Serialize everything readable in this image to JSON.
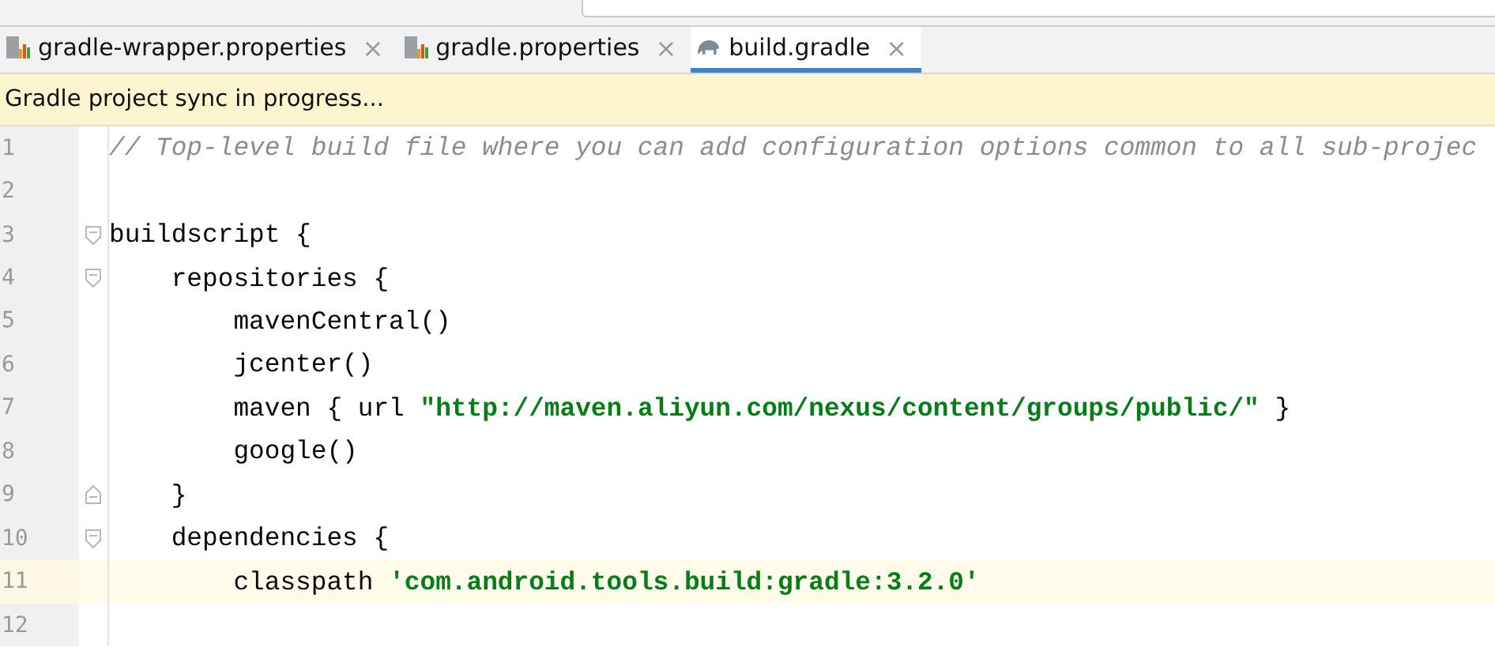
{
  "tabs": [
    {
      "label": "gradle-wrapper.properties",
      "kind": "properties",
      "close": "×",
      "selected": false
    },
    {
      "label": "gradle.properties",
      "kind": "properties",
      "close": "×",
      "selected": false
    },
    {
      "label": "build.gradle",
      "kind": "gradle",
      "close": "×",
      "selected": true
    }
  ],
  "notification": "Gradle project sync in progress...",
  "lines": [
    {
      "number": "1",
      "current": false,
      "segments": [
        {
          "kind": "comment",
          "text": "// Top-level build file where you can add configuration options common to all sub-projec"
        }
      ]
    },
    {
      "number": "2",
      "current": false
    },
    {
      "number": "3",
      "current": false,
      "fold_start": true,
      "segments": [
        {
          "kind": "code",
          "text": "buildscript {"
        }
      ]
    },
    {
      "number": "4",
      "current": false,
      "fold_start": true,
      "segments": [
        {
          "kind": "code",
          "text": "    repositories {"
        }
      ]
    },
    {
      "number": "5",
      "current": false,
      "segments": [
        {
          "kind": "code",
          "text": "        mavenCentral()"
        }
      ]
    },
    {
      "number": "6",
      "current": false,
      "segments": [
        {
          "kind": "code",
          "text": "        jcenter()"
        }
      ]
    },
    {
      "number": "7",
      "current": false,
      "segments": [
        {
          "kind": "code",
          "text": "        maven { url "
        },
        {
          "kind": "string",
          "text": "\"http://maven.aliyun.com/nexus/content/groups/public/\""
        },
        {
          "kind": "code",
          "text": " }"
        }
      ]
    },
    {
      "number": "8",
      "current": false,
      "segments": [
        {
          "kind": "code",
          "text": "        google()"
        }
      ]
    },
    {
      "number": "9",
      "current": false,
      "fold_end": true,
      "segments": [
        {
          "kind": "code",
          "text": "    }"
        }
      ]
    },
    {
      "number": "10",
      "current": false,
      "fold_start": true,
      "segments": [
        {
          "kind": "code",
          "text": "    dependencies {"
        }
      ]
    },
    {
      "number": "11",
      "current": true,
      "segments": [
        {
          "kind": "code",
          "text": "        classpath "
        },
        {
          "kind": "string",
          "text": "'com.android.tools.build:gradle:3.2.0'"
        }
      ]
    },
    {
      "number": "12",
      "current": false
    }
  ]
}
